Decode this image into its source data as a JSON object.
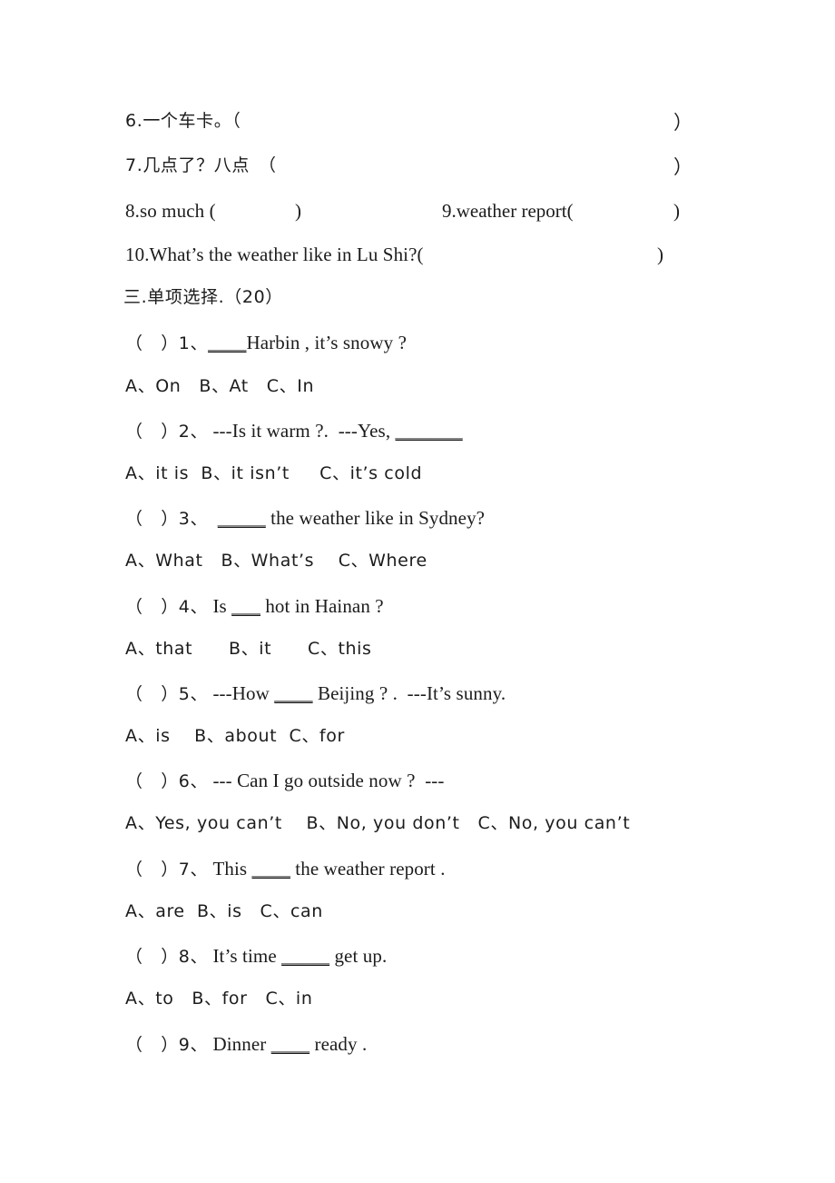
{
  "page": {
    "background": "#ffffff",
    "text_color": "#1c1c1c"
  },
  "translation_items": [
    {
      "id": "item-6",
      "text": "6.一个车卡。（",
      "close_paren": "）"
    },
    {
      "id": "item-7",
      "text": "7.几点了？八点　（",
      "close_paren": "）"
    },
    {
      "id": "item-8",
      "text": "8.so much (",
      "close_paren": ")"
    },
    {
      "id": "item-9",
      "text": "9.weather report(",
      "close_paren": ")"
    },
    {
      "id": "item-10",
      "text": "10.What’s the weather like in Lu Shi?(",
      "close_paren": ")"
    }
  ],
  "section": {
    "heading": "三.单项选择.（20）",
    "number": "三",
    "title": "单项选择",
    "points": "20"
  },
  "questions": [
    {
      "marker": "（　）1、",
      "prefix": "",
      "blank": "____",
      "suffix": "Harbin , it’s snowy ?",
      "options": "A、On   B、At   C、In"
    },
    {
      "marker": "（　）2、",
      "prefix": " ---Is it warm ?.  ---Yes, ",
      "blank": "_______",
      "suffix": "",
      "options": "A、it is  B、it isn’t     C、it’s cold"
    },
    {
      "marker": "（　）3、",
      "prefix": "  ",
      "blank": "_____",
      "suffix": " the weather like in Sydney?",
      "options": "A、What   B、What’s    C、Where"
    },
    {
      "marker": "（　）4、",
      "prefix": " Is ",
      "blank": "___",
      "suffix": " hot in Hainan ?",
      "options": "A、that      B、it      C、this"
    },
    {
      "marker": "（　）5、",
      "prefix": " ---How ",
      "blank": "____",
      "suffix": " Beijing ? .  ---It’s sunny.",
      "options": "A、is    B、about  C、for"
    },
    {
      "marker": "（　）6、",
      "prefix": " --- Can I go outside now ?  ---",
      "blank": "",
      "suffix": "",
      "options": "A、Yes, you can’t    B、No, you don’t   C、No, you can’t"
    },
    {
      "marker": "（　）7、",
      "prefix": " This ",
      "blank": "____",
      "suffix": " the weather report .",
      "options": "A、are  B、is   C、can"
    },
    {
      "marker": "（　）8、",
      "prefix": " It’s time ",
      "blank": "_____",
      "suffix": " get up.",
      "options": "A、to   B、for   C、in"
    },
    {
      "marker": "（　）9、",
      "prefix": " Dinner ",
      "blank": "____",
      "suffix": " ready .",
      "options": ""
    }
  ]
}
